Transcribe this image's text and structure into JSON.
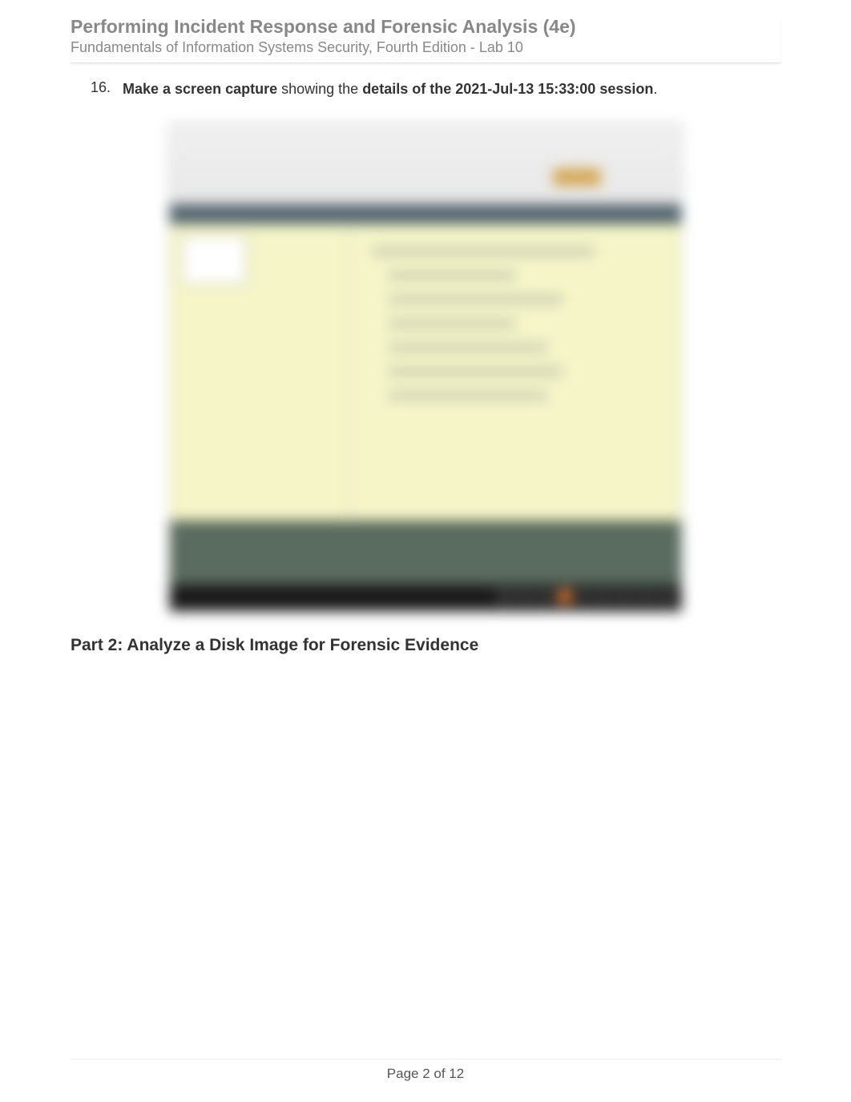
{
  "header": {
    "title": "Performing Incident Response and Forensic Analysis (4e)",
    "subtitle": "Fundamentals of Information Systems Security, Fourth Edition - Lab 10"
  },
  "content": {
    "list_item": {
      "number": "16.",
      "bold_prefix": "Make a screen capture",
      "middle_text": " showing the ",
      "bold_suffix": "details of the 2021-Jul-13 15:33:00 session",
      "period": "."
    },
    "section_heading": "Part 2: Analyze a Disk Image for Forensic Evidence"
  },
  "footer": {
    "page_label": "Page 2 of 12"
  }
}
